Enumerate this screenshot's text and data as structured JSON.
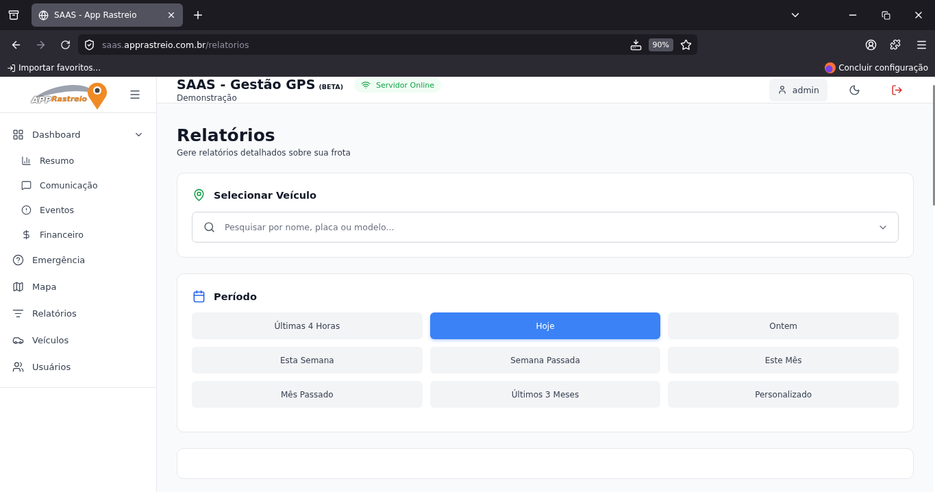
{
  "browser": {
    "tab_title": "SAAS - App Rastreio",
    "url_prefix": "saas.",
    "url_domain": "apprastreio.com.br",
    "url_path": "/relatorios",
    "zoom": "90%",
    "bookmark": "Importar favoritos...",
    "setup": "Concluir configuração"
  },
  "sidebar": {
    "logo": {
      "word_1": "APP",
      "word_2": "Rastreio"
    },
    "items": [
      {
        "label": "Dashboard",
        "expanded": true,
        "children": [
          {
            "label": "Resumo"
          },
          {
            "label": "Comunicação"
          },
          {
            "label": "Eventos"
          },
          {
            "label": "Financeiro"
          }
        ]
      },
      {
        "label": "Emergência"
      },
      {
        "label": "Mapa"
      },
      {
        "label": "Relatórios"
      },
      {
        "label": "Veículos"
      },
      {
        "label": "Usuários"
      }
    ]
  },
  "header": {
    "title": "SAAS - Gestão GPS",
    "badge": "(BETA)",
    "subtitle": "Demonstração",
    "status": "Servidor Online",
    "user": "admin"
  },
  "page": {
    "title": "Relatórios",
    "subtitle": "Gere relatórios detalhados sobre sua frota"
  },
  "vehicle_card": {
    "title": "Selecionar Veículo",
    "search": {
      "placeholder": "Pesquisar por nome, placa ou modelo..."
    }
  },
  "period_card": {
    "title": "Período",
    "options": [
      {
        "label": "Últimas 4 Horas",
        "selected": false
      },
      {
        "label": "Hoje",
        "selected": true
      },
      {
        "label": "Ontem",
        "selected": false
      },
      {
        "label": "Esta Semana",
        "selected": false
      },
      {
        "label": "Semana Passada",
        "selected": false
      },
      {
        "label": "Este Mês",
        "selected": false
      },
      {
        "label": "Mês Passado",
        "selected": false
      },
      {
        "label": "Últimos 3 Meses",
        "selected": false
      },
      {
        "label": "Personalizado",
        "selected": false
      }
    ]
  }
}
